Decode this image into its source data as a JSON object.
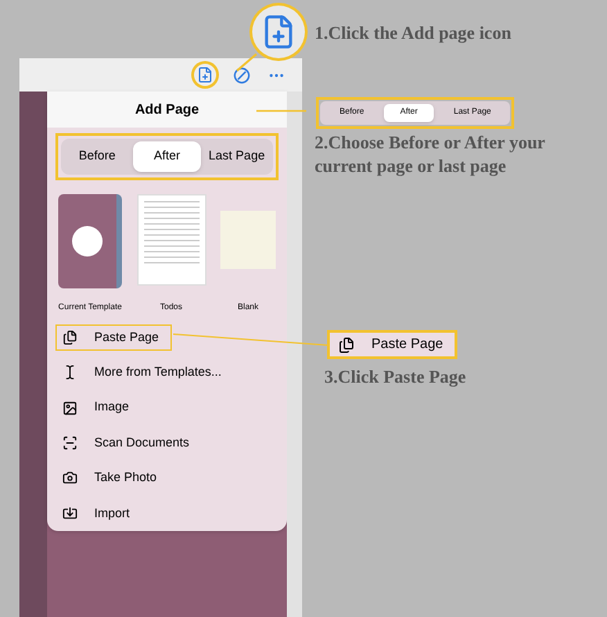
{
  "toolbar": {
    "add_page_highlighted": true
  },
  "popover": {
    "title": "Add Page",
    "position_tabs": [
      {
        "label": "Before",
        "selected": false
      },
      {
        "label": "After",
        "selected": true
      },
      {
        "label": "Last Page",
        "selected": false
      }
    ],
    "templates": [
      {
        "label": "Current Template",
        "kind": "cover"
      },
      {
        "label": "Todos",
        "kind": "lined"
      },
      {
        "label": "Blank",
        "kind": "blank"
      }
    ],
    "actions": [
      {
        "label": "Paste Page",
        "kind": "paste",
        "highlighted": true
      },
      {
        "label": "More from Templates...",
        "kind": "templates",
        "highlighted": false
      },
      {
        "label": "Image",
        "kind": "image",
        "highlighted": false
      },
      {
        "label": "Scan Documents",
        "kind": "scan",
        "highlighted": false
      },
      {
        "label": "Take Photo",
        "kind": "camera",
        "highlighted": false
      },
      {
        "label": "Import",
        "kind": "import",
        "highlighted": false
      }
    ]
  },
  "annotations": {
    "step_1": "1.Click the Add page icon",
    "step_2_tabs": [
      {
        "label": "Before",
        "selected": false
      },
      {
        "label": "After",
        "selected": true
      },
      {
        "label": "Last Page",
        "selected": false
      }
    ],
    "step_2": "2.Choose Before or After your current page or last page",
    "step_3_button": "Paste Page",
    "step_3": "3.Click Paste Page"
  }
}
